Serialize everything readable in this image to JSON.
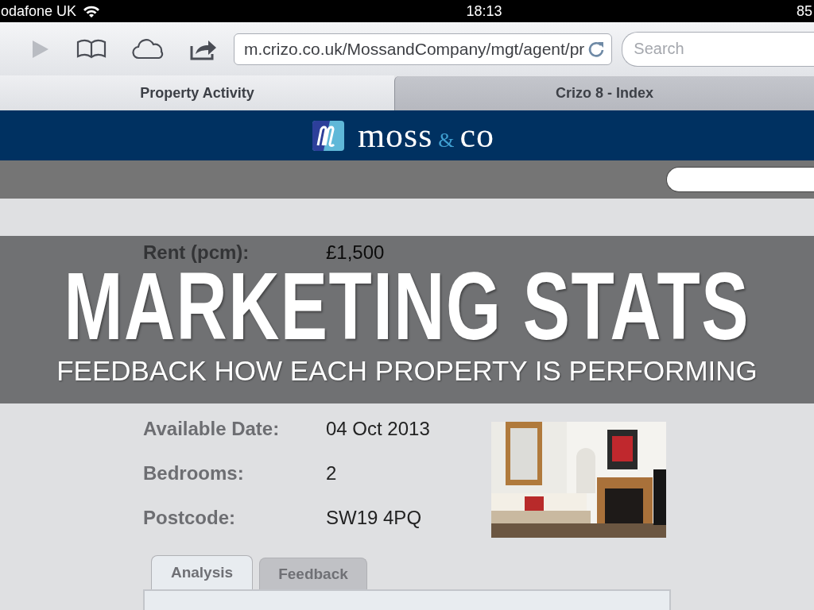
{
  "status_bar": {
    "carrier": "odafone UK",
    "time": "18:13",
    "battery": "85"
  },
  "browser": {
    "url": "m.crizo.co.uk/MossandCompany/mgt/agent/pr",
    "search": {
      "placeholder": "Search"
    }
  },
  "tabs": [
    {
      "label": "Property Activity",
      "selected": true
    },
    {
      "label": "Crizo 8 - Index",
      "selected": false
    }
  ],
  "header": {
    "logo": {
      "name": "moss",
      "ampersand": "&",
      "suffix": "co"
    }
  },
  "banner": {
    "row": {
      "label": "Rent (pcm):",
      "value": "£1,500"
    },
    "title": "MARKETING STATS",
    "subtitle": "FEEDBACK HOW EACH PROPERTY IS PERFORMING"
  },
  "details": [
    {
      "label": "Available Date:",
      "value": "04 Oct 2013"
    },
    {
      "label": "Bedrooms:",
      "value": "2"
    },
    {
      "label": "Postcode:",
      "value": "SW19 4PQ"
    }
  ],
  "panel_tabs": [
    {
      "label": "Analysis",
      "selected": true
    },
    {
      "label": "Feedback",
      "selected": false
    }
  ]
}
